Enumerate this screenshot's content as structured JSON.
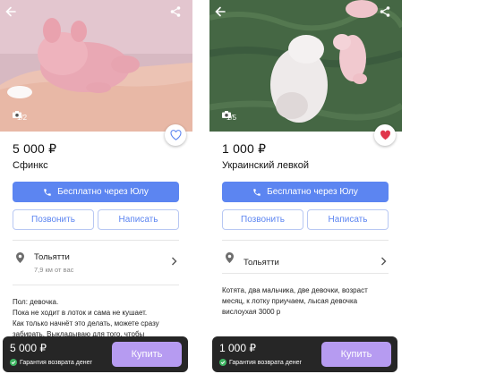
{
  "colors": {
    "accent": "#5c85f1",
    "buy_button": "#b69bf1",
    "bottom_bar": "#262626",
    "favorite_active": "#e0364b",
    "guarantee_check": "#3fb562"
  },
  "listings": [
    {
      "photo_counter": "1/2",
      "favorite": "inactive",
      "price": "5 000 ₽",
      "title": "Сфинкс",
      "call_via_app": "Бесплатно через Юлу",
      "call_button": "Позвонить",
      "message_button": "Написать",
      "city": "Тольятти",
      "distance": "7,9 км от вас",
      "description": [
        "Пол: девочка.",
        "Пока не ходит в лоток и сама не кушает.",
        "Как только начнёт это делать, можете сразу",
        "забирать. Выкладываю для того, чтобы"
      ],
      "bottom": {
        "price": "5 000 ₽",
        "guarantee": "Гарантия возврата денег",
        "buy": "Купить"
      }
    },
    {
      "photo_counter": "1/5",
      "favorite": "active",
      "price": "1 000 ₽",
      "title": "Украинский левкой",
      "call_via_app": "Бесплатно через Юлу",
      "call_button": "Позвонить",
      "message_button": "Написать",
      "city": "Тольятти",
      "distance": "",
      "description": [
        "Котята, два мальчика, две девочки, возраст",
        "месяц, к лотку приучаем, лысая девочка",
        "вислоухая 3000 р"
      ],
      "bottom": {
        "price": "1 000 ₽",
        "guarantee": "Гарантия возврата денег",
        "buy": "Купить"
      }
    }
  ]
}
